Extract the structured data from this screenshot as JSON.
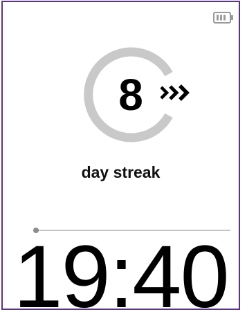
{
  "colors": {
    "frame": "#5a3480",
    "ring": "#c9c9c9",
    "text": "#000000",
    "battery": "#9a9a9a",
    "track": "#c4c4c4",
    "knob": "#8c8c8c"
  },
  "status": {
    "battery_icon": "battery-icon",
    "battery_level": 0.75
  },
  "streak": {
    "count": "8",
    "chevron_icon": "chevron-triple-right-icon",
    "label": "day streak"
  },
  "progress": {
    "value": 0.0
  },
  "clock": {
    "time": "19:40"
  }
}
